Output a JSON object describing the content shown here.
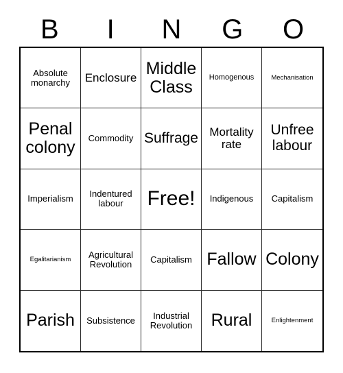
{
  "card": {
    "header_letters": [
      "B",
      "I",
      "N",
      "G",
      "O"
    ],
    "rows": [
      [
        {
          "text": "Absolute monarchy",
          "size": "fs-sm"
        },
        {
          "text": "Enclosure",
          "size": "fs-md"
        },
        {
          "text": "Middle Class",
          "size": "fs-xl"
        },
        {
          "text": "Homogenous",
          "size": "fs-xs"
        },
        {
          "text": "Mechanisation",
          "size": "fs-xxs"
        }
      ],
      [
        {
          "text": "Penal colony",
          "size": "fs-xl"
        },
        {
          "text": "Commodity",
          "size": "fs-sm"
        },
        {
          "text": "Suffrage",
          "size": "fs-lg"
        },
        {
          "text": "Mortality rate",
          "size": "fs-md"
        },
        {
          "text": "Unfree labour",
          "size": "fs-lg"
        }
      ],
      [
        {
          "text": "Imperialism",
          "size": "fs-sm"
        },
        {
          "text": "Indentured labour",
          "size": "fs-sm"
        },
        {
          "text": "Free!",
          "size": "fs-xxl"
        },
        {
          "text": "Indigenous",
          "size": "fs-sm"
        },
        {
          "text": "Capitalism",
          "size": "fs-sm"
        }
      ],
      [
        {
          "text": "Egalitarianism",
          "size": "fs-xxs"
        },
        {
          "text": "Agricultural Revolution",
          "size": "fs-sm"
        },
        {
          "text": "Capitalism",
          "size": "fs-sm"
        },
        {
          "text": "Fallow",
          "size": "fs-xl"
        },
        {
          "text": "Colony",
          "size": "fs-xl"
        }
      ],
      [
        {
          "text": "Parish",
          "size": "fs-xl"
        },
        {
          "text": "Subsistence",
          "size": "fs-sm"
        },
        {
          "text": "Industrial Revolution",
          "size": "fs-sm"
        },
        {
          "text": "Rural",
          "size": "fs-xl"
        },
        {
          "text": "Enlightenment",
          "size": "fs-xxs"
        }
      ]
    ],
    "free_space": {
      "row": 3,
      "col": 3,
      "label": "Free!"
    },
    "colors": {
      "background": "#ffffff",
      "text": "#000000",
      "outer_border": "#000000",
      "inner_border": "#2b2b2b"
    }
  }
}
